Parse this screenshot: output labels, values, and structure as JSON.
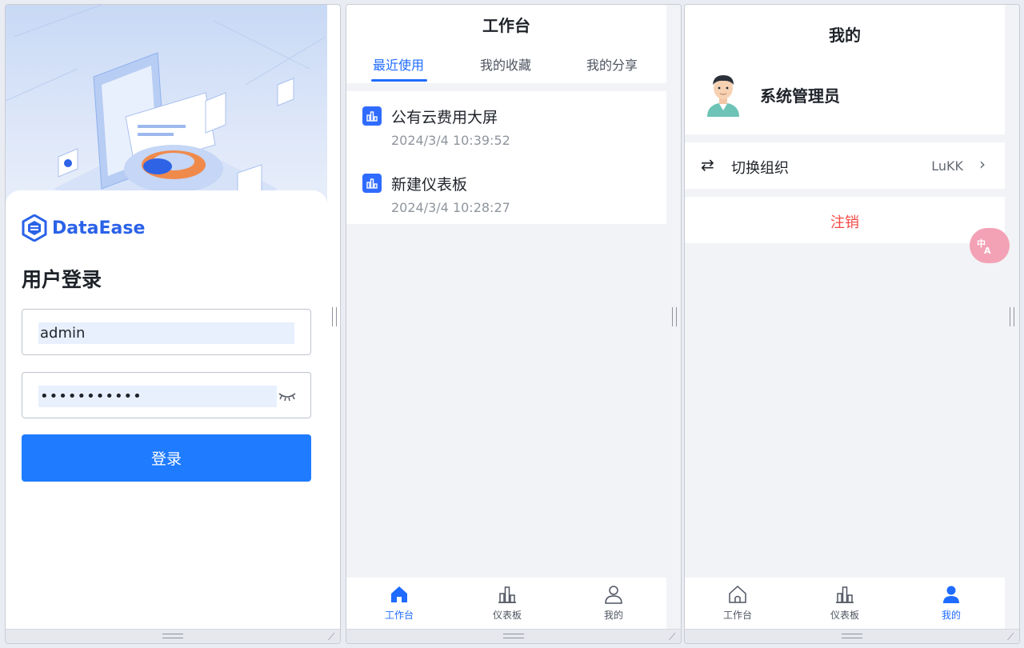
{
  "login": {
    "brand": "DataEase",
    "title": "用户登录",
    "username_value": "admin",
    "password_value": "•••••••••••",
    "login_label": "登录"
  },
  "workbench": {
    "title": "工作台",
    "tabs": [
      {
        "label": "最近使用",
        "active": true
      },
      {
        "label": "我的收藏",
        "active": false
      },
      {
        "label": "我的分享",
        "active": false
      }
    ],
    "items": [
      {
        "title": "公有云费用大屏",
        "time": "2024/3/4 10:39:52"
      },
      {
        "title": "新建仪表板",
        "time": "2024/3/4 10:28:27"
      }
    ],
    "nav": [
      {
        "label": "工作台",
        "icon": "home-icon",
        "active": true
      },
      {
        "label": "仪表板",
        "icon": "dashboard-icon",
        "active": false
      },
      {
        "label": "我的",
        "icon": "user-icon",
        "active": false
      }
    ]
  },
  "mine": {
    "title": "我的",
    "user_name": "系统管理员",
    "switch_org_label": "切换组织",
    "org_value": "LuKK",
    "logout_label": "注销",
    "nav": [
      {
        "label": "工作台",
        "icon": "home-icon",
        "active": false
      },
      {
        "label": "仪表板",
        "icon": "dashboard-icon",
        "active": false
      },
      {
        "label": "我的",
        "icon": "user-icon",
        "active": true
      }
    ]
  },
  "colors": {
    "accent": "#1f6bff",
    "button": "#1f7bff",
    "danger": "#f54a45"
  }
}
